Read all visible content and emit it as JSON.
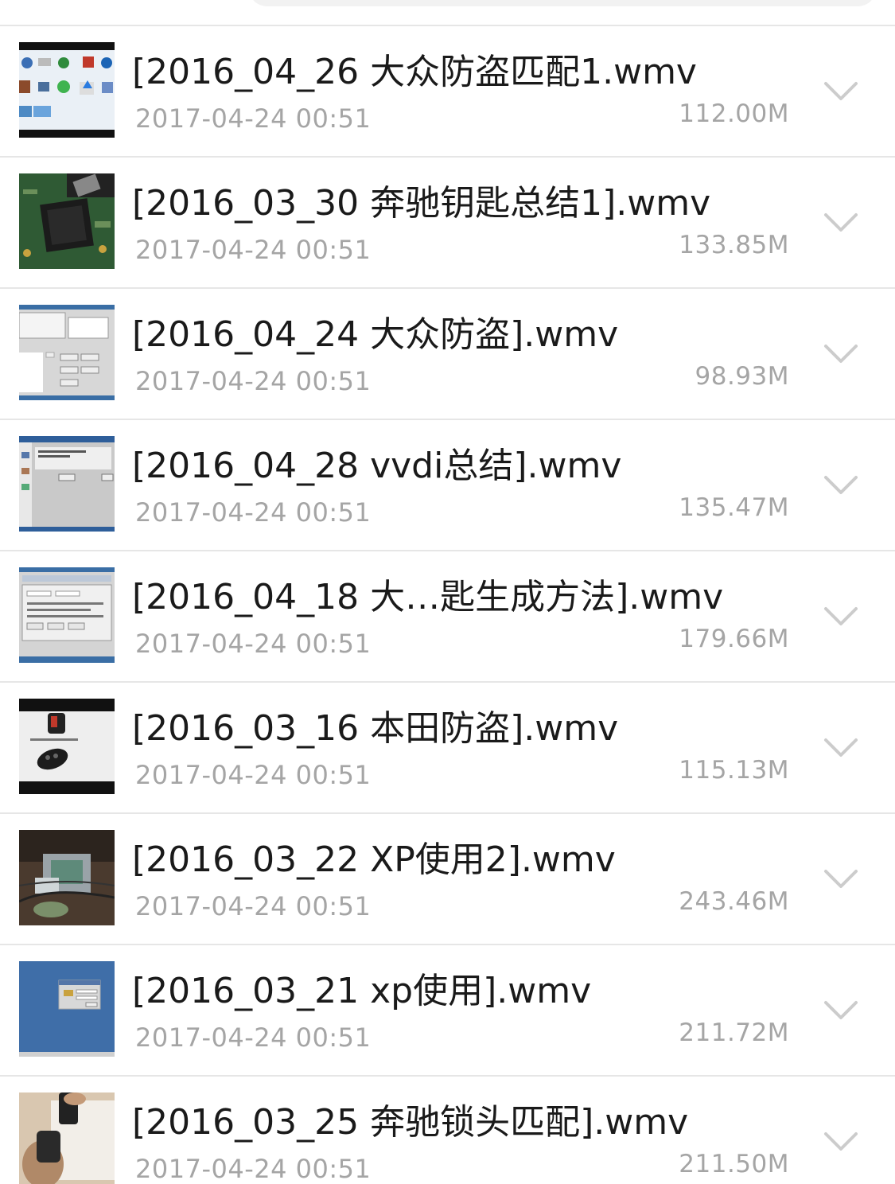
{
  "files": [
    {
      "name": "[2016_04_26 大众防盗匹配1.wmv",
      "date": "2017-04-24 00:51",
      "size": "112.00M",
      "thumb": "thumb-vw-brands"
    },
    {
      "name": "[2016_03_30 奔驰钥匙总结1].wmv",
      "date": "2017-04-24 00:51",
      "size": "133.85M",
      "thumb": "thumb-circuit-board"
    },
    {
      "name": "[2016_04_24 大众防盗].wmv",
      "date": "2017-04-24 00:51",
      "size": "98.93M",
      "thumb": "thumb-software-window"
    },
    {
      "name": "[2016_04_28 vvdi总结].wmv",
      "date": "2017-04-24 00:51",
      "size": "135.47M",
      "thumb": "thumb-software-dialog"
    },
    {
      "name": "[2016_04_18 大…匙生成方法].wmv",
      "date": "2017-04-24 00:51",
      "size": "179.66M",
      "thumb": "thumb-software-form"
    },
    {
      "name": "[2016_03_16 本田防盗].wmv",
      "date": "2017-04-24 00:51",
      "size": "115.13M",
      "thumb": "thumb-car-key"
    },
    {
      "name": "[2016_03_22 XP使用2].wmv",
      "date": "2017-04-24 00:51",
      "size": "243.46M",
      "thumb": "thumb-device-photo"
    },
    {
      "name": "[2016_03_21 xp使用].wmv",
      "date": "2017-04-24 00:51",
      "size": "211.72M",
      "thumb": "thumb-blue-desktop"
    },
    {
      "name": "[2016_03_25 奔驰锁头匹配].wmv",
      "date": "2017-04-24 00:51",
      "size": "211.50M",
      "thumb": "thumb-hands-lock"
    }
  ],
  "colors": {
    "title": "#1a1a1a",
    "meta": "#a5a5a5",
    "divider": "#e6e6e6",
    "chevron": "#cccccc"
  }
}
